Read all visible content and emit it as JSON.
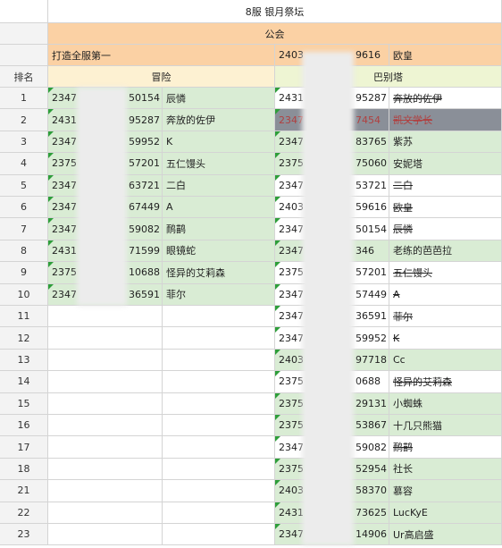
{
  "header": {
    "title": "8服 银月祭坛",
    "guild_label": "公会",
    "guild_left": "打造全服第一",
    "guild_right_id": "2403",
    "guild_right_id_end": "9616",
    "guild_right_name": "欧皇",
    "rank_label": "排名",
    "team_left": "冒险",
    "team_right": "巴别塔"
  },
  "rows": [
    {
      "rank": "1",
      "lid": "2347",
      "lid_end": "50154",
      "lname": "辰憐",
      "rid": "2431",
      "rid_end": "95287",
      "rname": "奔放的佐伊"
    },
    {
      "rank": "2",
      "lid": "2431",
      "lid_end": "95287",
      "lname": "奔放的佐伊",
      "rid": "2347",
      "rid_end": "7454",
      "rname": "凯文学长"
    },
    {
      "rank": "3",
      "lid": "2347",
      "lid_end": "59952",
      "lname": "K",
      "rid": "2347",
      "rid_end": "83765",
      "rname": "紫苏"
    },
    {
      "rank": "4",
      "lid": "2375",
      "lid_end": "57201",
      "lname": "五仁馒头",
      "rid": "2375",
      "rid_end": "75060",
      "rname": "安妮塔"
    },
    {
      "rank": "5",
      "lid": "2347",
      "lid_end": "63721",
      "lname": "二白",
      "rid": "2347",
      "rid_end": "53721",
      "rname": "二白"
    },
    {
      "rank": "6",
      "lid": "2347",
      "lid_end": "67449",
      "lname": "A",
      "rid": "2403",
      "rid_end": "59616",
      "rname": "欧皇"
    },
    {
      "rank": "7",
      "lid": "2347",
      "lid_end": "59082",
      "lname": "鸸鹋",
      "rid": "2347",
      "rid_end": "50154",
      "rname": "辰憐"
    },
    {
      "rank": "8",
      "lid": "2431",
      "lid_end": "71599",
      "lname": "眼镜蛇",
      "rid": "2347",
      "rid_end": "346",
      "rname": "老练的芭芭拉"
    },
    {
      "rank": "9",
      "lid": "2375",
      "lid_end": "10688",
      "lname": "怪异的艾莉森",
      "rid": "2375",
      "rid_end": "57201",
      "rname": "五仁馒头"
    },
    {
      "rank": "10",
      "lid": "2347",
      "lid_end": "36591",
      "lname": "菲尔",
      "rid": "2347",
      "rid_end": "57449",
      "rname": "A"
    },
    {
      "rank": "11",
      "rid": "2347",
      "rid_end": "36591",
      "rname": "菲尔"
    },
    {
      "rank": "12",
      "rid": "2347",
      "rid_end": "59952",
      "rname": "K"
    },
    {
      "rank": "13",
      "rid": "2403",
      "rid_end": "97718",
      "rname": "Cc"
    },
    {
      "rank": "14",
      "rid": "2375",
      "rid_end": "0688",
      "rname": "怪异的艾莉森"
    },
    {
      "rank": "15",
      "rid": "2375",
      "rid_end": "29131",
      "rname": "小蜘蛛"
    },
    {
      "rank": "16",
      "rid": "2375",
      "rid_end": "53867",
      "rname": "十几只熊猫"
    },
    {
      "rank": "17",
      "rid": "2347",
      "rid_end": "59082",
      "rname": "鸸鹋"
    },
    {
      "rank": "18",
      "rid": "2375",
      "rid_end": "52954",
      "rname": "社长"
    },
    {
      "rank": "21",
      "rid": "2403",
      "rid_end": "58370",
      "rname": "慕容"
    },
    {
      "rank": "22",
      "rid": "2431",
      "rid_end": "73625",
      "rname": "LucKyE"
    },
    {
      "rank": "23",
      "rid": "2347",
      "rid_end": "14906",
      "rname": "Ur高启盛"
    }
  ]
}
